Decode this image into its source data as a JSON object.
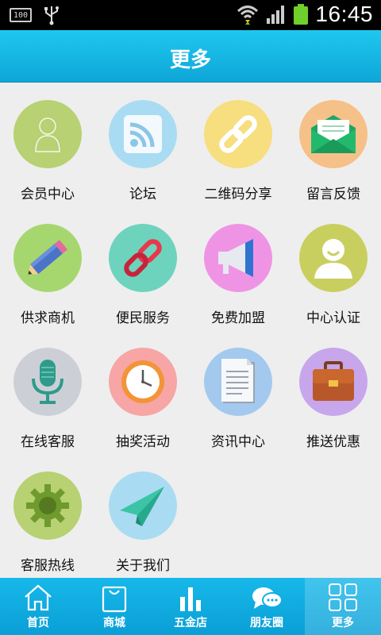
{
  "status_bar": {
    "battery_level": "100",
    "time": "16:45"
  },
  "header": {
    "title": "更多"
  },
  "grid": {
    "items": [
      {
        "label": "会员中心",
        "icon": "user-icon",
        "color": "#b7d173"
      },
      {
        "label": "论坛",
        "icon": "rss-icon",
        "color": "#a9dcf2"
      },
      {
        "label": "二维码分享",
        "icon": "link-icon",
        "color": "#f7de7f"
      },
      {
        "label": "留言反馈",
        "icon": "envelope-icon",
        "color": "#f6c089"
      },
      {
        "label": "供求商机",
        "icon": "pencil-icon",
        "color": "#a6d76f"
      },
      {
        "label": "便民服务",
        "icon": "chain-icon",
        "color": "#6dd3bd"
      },
      {
        "label": "免费加盟",
        "icon": "megaphone-icon",
        "color": "#ef94e4"
      },
      {
        "label": "中心认证",
        "icon": "user-avatar-icon",
        "color": "#c9cf5f"
      },
      {
        "label": "在线客服",
        "icon": "microphone-icon",
        "color": "#ccd0d6"
      },
      {
        "label": "抽奖活动",
        "icon": "clock-icon",
        "color": "#f7a5a5"
      },
      {
        "label": "资讯中心",
        "icon": "document-icon",
        "color": "#a3c9ee"
      },
      {
        "label": "推送优惠",
        "icon": "briefcase-icon",
        "color": "#c7a6ec"
      },
      {
        "label": "客服热线",
        "icon": "gear-icon",
        "color": "#b7d173"
      },
      {
        "label": "关于我们",
        "icon": "paper-plane-icon",
        "color": "#a9dcf2"
      }
    ]
  },
  "bottom_nav": {
    "items": [
      {
        "label": "首页",
        "icon": "home-icon"
      },
      {
        "label": "商城",
        "icon": "shopping-bag-icon"
      },
      {
        "label": "五金店",
        "icon": "bar-chart-icon"
      },
      {
        "label": "朋友圈",
        "icon": "chat-bubbles-icon"
      },
      {
        "label": "更多",
        "icon": "grid-icon",
        "active": true
      }
    ]
  }
}
